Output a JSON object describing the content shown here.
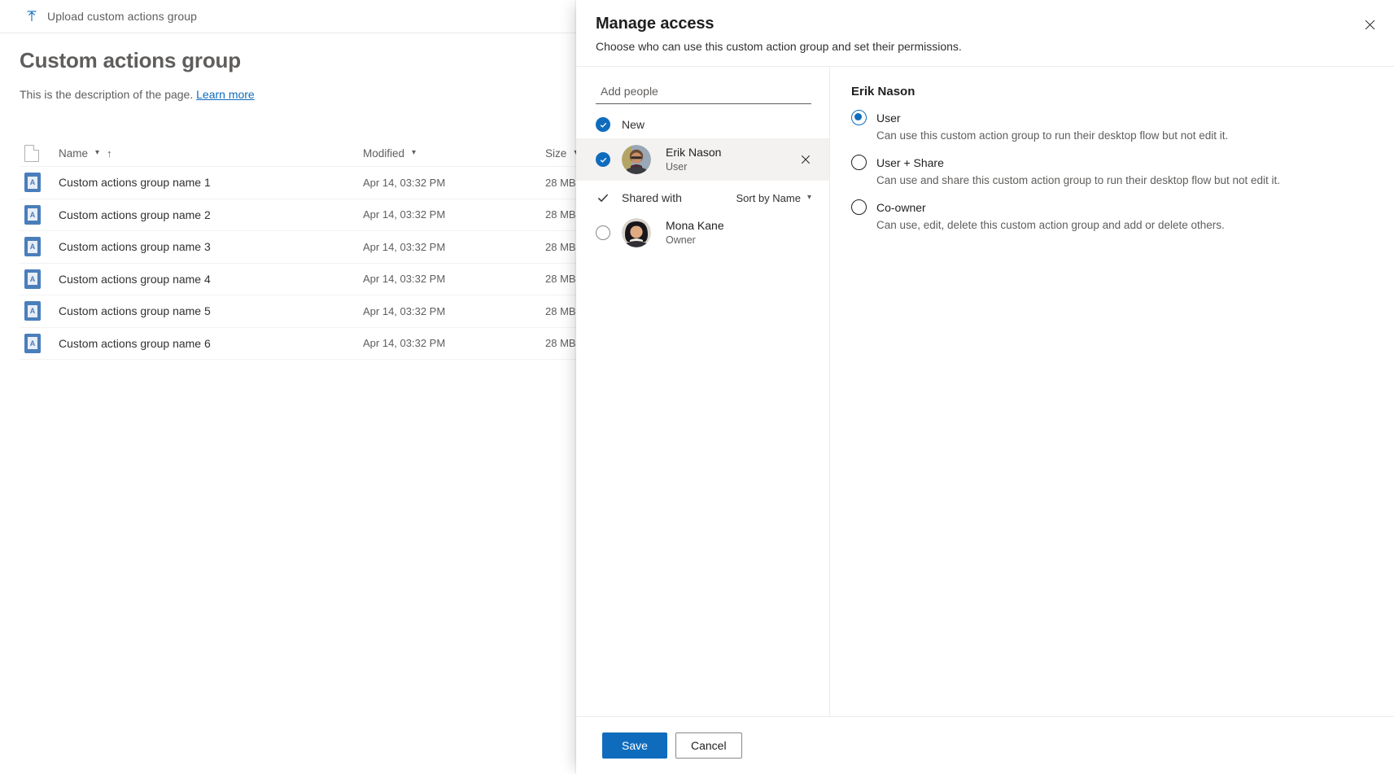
{
  "background": {
    "command_bar": {
      "upload_label": "Upload custom actions group",
      "upload_icon": "upload-arrow-icon"
    },
    "page_title": "Custom actions group",
    "description_text": "This is the description of the page.",
    "learn_more_label": "Learn more",
    "table": {
      "columns": [
        "Name",
        "Modified",
        "Size"
      ],
      "rows": [
        {
          "name": "Custom actions group name 1",
          "modified": "Apr 14, 03:32 PM",
          "size": "28 MB"
        },
        {
          "name": "Custom actions group name 2",
          "modified": "Apr 14, 03:32 PM",
          "size": "28 MB"
        },
        {
          "name": "Custom actions group name 3",
          "modified": "Apr 14, 03:32 PM",
          "size": "28 MB"
        },
        {
          "name": "Custom actions group name 4",
          "modified": "Apr 14, 03:32 PM",
          "size": "28 MB"
        },
        {
          "name": "Custom actions group name 5",
          "modified": "Apr 14, 03:32 PM",
          "size": "28 MB"
        },
        {
          "name": "Custom actions group name 6",
          "modified": "Apr 14, 03:32 PM",
          "size": "28 MB"
        }
      ]
    }
  },
  "panel": {
    "title": "Manage access",
    "subtitle": "Choose who can use this custom action group and set their permissions.",
    "close_icon": "close-icon",
    "search": {
      "placeholder": "Add people",
      "value": ""
    },
    "groups": [
      {
        "label": "New",
        "checked": true
      },
      {
        "label": "Shared with",
        "checked": true,
        "sort_label": "Sort by Name"
      }
    ],
    "new_people": [
      {
        "name": "Erik Nason",
        "role": "User",
        "selected": true,
        "checked": true,
        "remove_icon": "close-icon"
      }
    ],
    "shared_people": [
      {
        "name": "Mona Kane",
        "role": "Owner",
        "selected": false,
        "checked": false
      }
    ],
    "permissions": {
      "subject": "Erik Nason",
      "options": [
        {
          "label": "User",
          "description": "Can use this custom action group to run their desktop flow but not edit it.",
          "selected": true
        },
        {
          "label": "User + Share",
          "description": "Can use and share this custom action group to run their desktop flow but not edit it.",
          "selected": false
        },
        {
          "label": "Co-owner",
          "description": "Can use, edit, delete this custom action group and add or delete others.",
          "selected": false
        }
      ]
    },
    "footer": {
      "save_label": "Save",
      "cancel_label": "Cancel"
    }
  },
  "colors": {
    "accent": "#0f6cbd",
    "divider": "#edebe9",
    "selected_row": "#f3f2f1"
  }
}
